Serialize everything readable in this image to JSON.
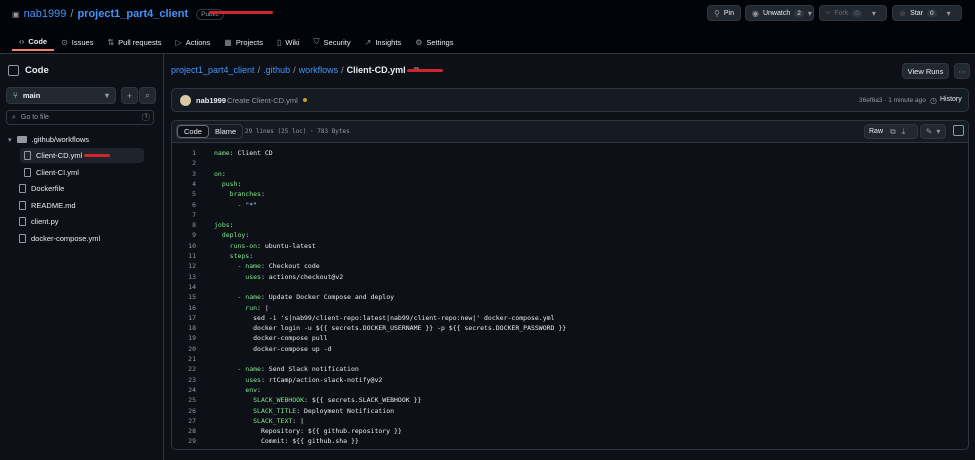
{
  "header": {
    "owner": "nab1999",
    "repo": "project1_part4_client",
    "visibility": "Public",
    "pin_label": "Pin",
    "unwatch_label": "Unwatch",
    "unwatch_count": "2",
    "fork_label": "Fork",
    "fork_count": "0",
    "star_label": "Star",
    "star_count": "0"
  },
  "tabs": [
    {
      "label": "Code",
      "icon": "code-icon"
    },
    {
      "label": "Issues",
      "icon": "issue-icon"
    },
    {
      "label": "Pull requests",
      "icon": "pull-request-icon"
    },
    {
      "label": "Actions",
      "icon": "play-icon"
    },
    {
      "label": "Projects",
      "icon": "table-icon"
    },
    {
      "label": "Wiki",
      "icon": "book-icon"
    },
    {
      "label": "Security",
      "icon": "shield-icon"
    },
    {
      "label": "Insights",
      "icon": "graph-icon"
    },
    {
      "label": "Settings",
      "icon": "gear-icon"
    }
  ],
  "sidebar": {
    "title": "Code",
    "branch": "main",
    "search_placeholder": "Go to file",
    "search_shortcut": "t",
    "tree": [
      {
        "label": ".github/workflows",
        "type": "folder"
      },
      {
        "label": "Client-CD.yml",
        "type": "file",
        "selected": true
      },
      {
        "label": "Client-CI.yml",
        "type": "file"
      },
      {
        "label": "Dockerfile",
        "type": "file"
      },
      {
        "label": "README.md",
        "type": "file"
      },
      {
        "label": "client.py",
        "type": "file"
      },
      {
        "label": "docker-compose.yml",
        "type": "file"
      }
    ]
  },
  "breadcrumb": {
    "repo": "project1_part4_client",
    "dir1": ".github",
    "dir2": "workflows",
    "file": "Client-CD.yml"
  },
  "view_runs_label": "View Runs",
  "commit": {
    "author": "nab1999",
    "message": "Create Client-CD.yml",
    "sha_time": "36ef6a3 · 1 minute ago",
    "history_label": "History",
    "status_color": "#d29922"
  },
  "file": {
    "code_tab": "Code",
    "blame_tab": "Blame",
    "meta": "29 lines (25 loc) · 783 Bytes",
    "raw_label": "Raw",
    "lines": [
      [
        "name",
        ": Client CD"
      ],
      [
        "",
        ""
      ],
      [
        "on",
        ":"
      ],
      [
        "  push",
        ":"
      ],
      [
        "    branches",
        ":"
      ],
      [
        "      - ",
        "\"*\""
      ],
      [
        "",
        ""
      ],
      [
        "jobs",
        ":"
      ],
      [
        "  deploy",
        ":"
      ],
      [
        "    runs-on",
        ": ubuntu-latest"
      ],
      [
        "    steps",
        ":"
      ],
      [
        "      - name",
        ": Checkout code"
      ],
      [
        "        uses",
        ": actions/checkout@v2"
      ],
      [
        "",
        ""
      ],
      [
        "      - name",
        ": Update Docker Compose and deploy"
      ],
      [
        "        run",
        ": |"
      ],
      [
        "",
        "          sed -i 's|nab99/client-repo:latest|nab99/client-repo:new|' docker-compose.yml"
      ],
      [
        "",
        "          docker login -u ${{ secrets.DOCKER_USERNAME }} -p ${{ secrets.DOCKER_PASSWORD }}"
      ],
      [
        "",
        "          docker-compose pull"
      ],
      [
        "",
        "          docker-compose up -d"
      ],
      [
        "",
        ""
      ],
      [
        "      - name",
        ": Send Slack notification"
      ],
      [
        "        uses",
        ": rtCamp/action-slack-notify@v2"
      ],
      [
        "        env",
        ":"
      ],
      [
        "          SLACK_WEBHOOK",
        ": ${{ secrets.SLACK_WEBHOOK }}"
      ],
      [
        "          SLACK_TITLE",
        ": Deployment Notification"
      ],
      [
        "          SLACK_TEXT",
        ": |"
      ],
      [
        "",
        "            Repository: ${{ github.repository }}"
      ],
      [
        "",
        "            Commit: ${{ github.sha }}"
      ]
    ]
  }
}
